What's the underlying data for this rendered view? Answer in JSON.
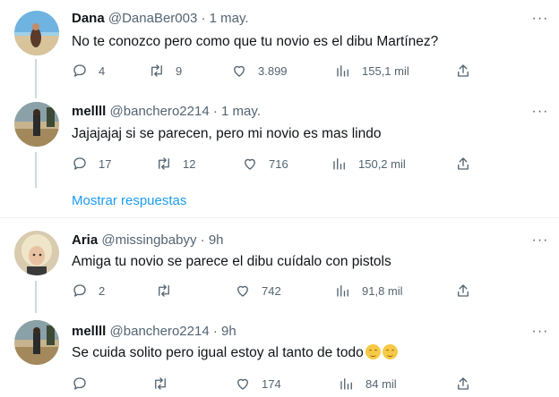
{
  "tweets": [
    {
      "name": "Dana",
      "handle": "@DanaBer003",
      "date": "1 may.",
      "text": "No te conozco pero como que tu novio es el dibu Martínez?",
      "replies": "4",
      "retweets": "9",
      "likes": "3.899",
      "views": "155,1 mil"
    },
    {
      "name": "mellll",
      "handle": "@banchero2214",
      "date": "1 may.",
      "text": "Jajajajaj si se parecen, pero mi novio es mas lindo",
      "replies": "17",
      "retweets": "12",
      "likes": "716",
      "views": "150,2 mil"
    },
    {
      "name": "Aria",
      "handle": "@missingbabyy",
      "date": "9h",
      "text": "Amiga tu novio se parece el dibu cuídalo con pistols",
      "replies": "2",
      "retweets": "",
      "likes": "742",
      "views": "91,8 mil"
    },
    {
      "name": "mellll",
      "handle": "@banchero2214",
      "date": "9h",
      "text": "Se cuida solito pero igual estoy al tanto de todo",
      "replies": "",
      "retweets": "",
      "likes": "174",
      "views": "84 mil"
    }
  ],
  "separator": "·",
  "more_glyph": "···",
  "show_replies": "Mostrar respuestas",
  "colors": {
    "accent": "#1d9bf0",
    "secondary_text": "#536471",
    "thread_line": "#cfd9de"
  },
  "icons": [
    "reply-icon",
    "retweet-icon",
    "like-icon",
    "views-icon",
    "share-icon",
    "more-icon",
    "smiling-face-emoji"
  ]
}
